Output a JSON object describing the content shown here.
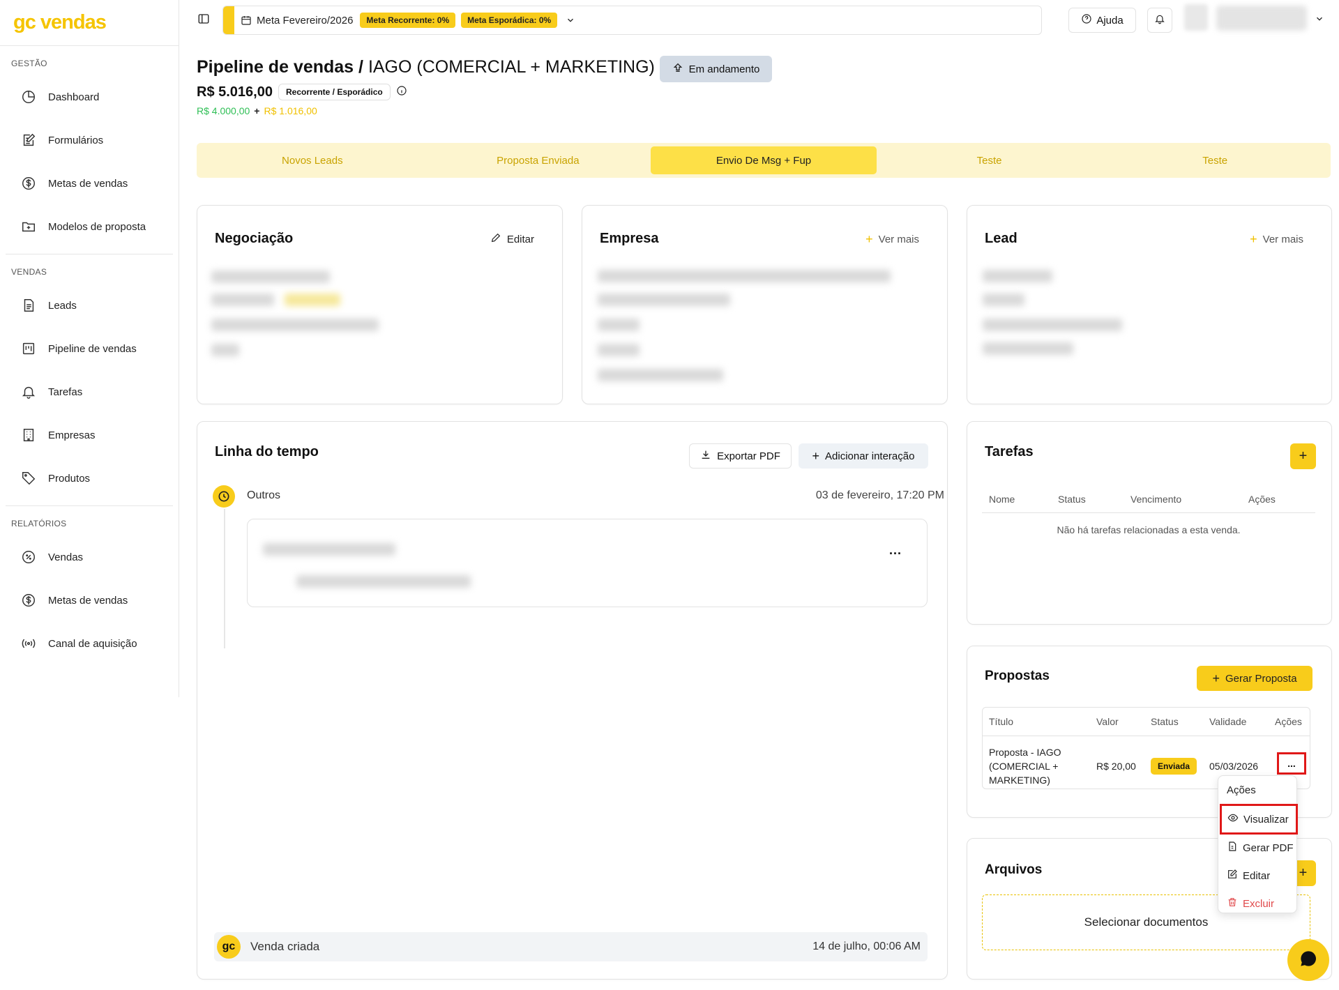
{
  "brand": {
    "logo_text": "gc vendas"
  },
  "sidebar": {
    "sections": [
      {
        "title": "GESTÃO",
        "items": [
          {
            "label": "Dashboard",
            "icon": "pie-chart-icon"
          },
          {
            "label": "Formulários",
            "icon": "form-edit-icon"
          },
          {
            "label": "Metas de vendas",
            "icon": "dollar-circle-icon"
          },
          {
            "label": "Modelos de proposta",
            "icon": "folder-plus-icon"
          }
        ]
      },
      {
        "title": "VENDAS",
        "items": [
          {
            "label": "Leads",
            "icon": "document-icon"
          },
          {
            "label": "Pipeline de vendas",
            "icon": "kanban-icon"
          },
          {
            "label": "Tarefas",
            "icon": "bell-icon"
          },
          {
            "label": "Empresas",
            "icon": "building-icon"
          },
          {
            "label": "Produtos",
            "icon": "tag-icon"
          }
        ]
      },
      {
        "title": "RELATÓRIOS",
        "items": [
          {
            "label": "Vendas",
            "icon": "percent-circle-icon"
          },
          {
            "label": "Metas de vendas",
            "icon": "dollar-circle-icon"
          },
          {
            "label": "Canal de aquisição",
            "icon": "radio-waves-icon"
          }
        ]
      }
    ]
  },
  "topbar": {
    "goal_label": "Meta Fevereiro/2026",
    "recurring_badge": "Meta Recorrente: 0%",
    "sporadic_badge": "Meta Esporádica: 0%",
    "help_label": "Ajuda"
  },
  "header": {
    "title": "Pipeline de vendas /",
    "subtitle": "IAGO (COMERCIAL + MARKETING)",
    "status": "Em andamento",
    "total": "R$ 5.016,00",
    "type_badge": "Recorrente / Esporádico",
    "recurring_value": "R$ 4.000,00",
    "plus": "+",
    "sporadic_value": "R$ 1.016,00"
  },
  "stages": [
    {
      "label": "Novos Leads",
      "active": false
    },
    {
      "label": "Proposta Enviada",
      "active": false
    },
    {
      "label": "Envio De Msg + Fup",
      "active": true
    },
    {
      "label": "Teste",
      "active": false
    },
    {
      "label": "Teste",
      "active": false
    }
  ],
  "negotiation": {
    "title": "Negociação",
    "edit_label": "Editar"
  },
  "company": {
    "title": "Empresa",
    "more_label": "Ver mais"
  },
  "lead": {
    "title": "Lead",
    "more_label": "Ver mais"
  },
  "timeline": {
    "title": "Linha do tempo",
    "export_label": "Exportar PDF",
    "add_label": "Adicionar interação",
    "entry_type": "Outros",
    "entry_date": "03 de fevereiro, 17:20 PM",
    "entry_menu": "...",
    "created_badge": "gc",
    "created_label": "Venda criada",
    "created_date": "14 de julho, 00:06 AM"
  },
  "tasks": {
    "title": "Tarefas",
    "add_label": "+",
    "columns": [
      "Nome",
      "Status",
      "Vencimento",
      "Ações"
    ],
    "empty": "Não há tarefas relacionadas a esta venda."
  },
  "proposals": {
    "title": "Propostas",
    "generate_label": "Gerar Proposta",
    "columns": [
      "Título",
      "Valor",
      "Status",
      "Validade",
      "Ações"
    ],
    "rows": [
      {
        "title_lines": [
          "Proposta - IAGO",
          "(COMERCIAL +",
          "MARKETING)"
        ],
        "value": "R$ 20,00",
        "status": "Enviada",
        "validity": "05/03/2026",
        "actions": "..."
      }
    ]
  },
  "actions_menu": {
    "title": "Ações",
    "items": [
      {
        "label": "Visualizar",
        "icon": "eye-icon"
      },
      {
        "label": "Gerar PDF",
        "icon": "file-pdf-icon"
      },
      {
        "label": "Editar",
        "icon": "edit-icon"
      },
      {
        "label": "Excluir",
        "icon": "trash-icon"
      }
    ]
  },
  "files": {
    "title": "Arquivos",
    "dropzone_label": "Selecionar documentos"
  },
  "colors": {
    "accent": "#f8cc1b",
    "highlight": "#e01818",
    "green": "#2fbf56"
  }
}
